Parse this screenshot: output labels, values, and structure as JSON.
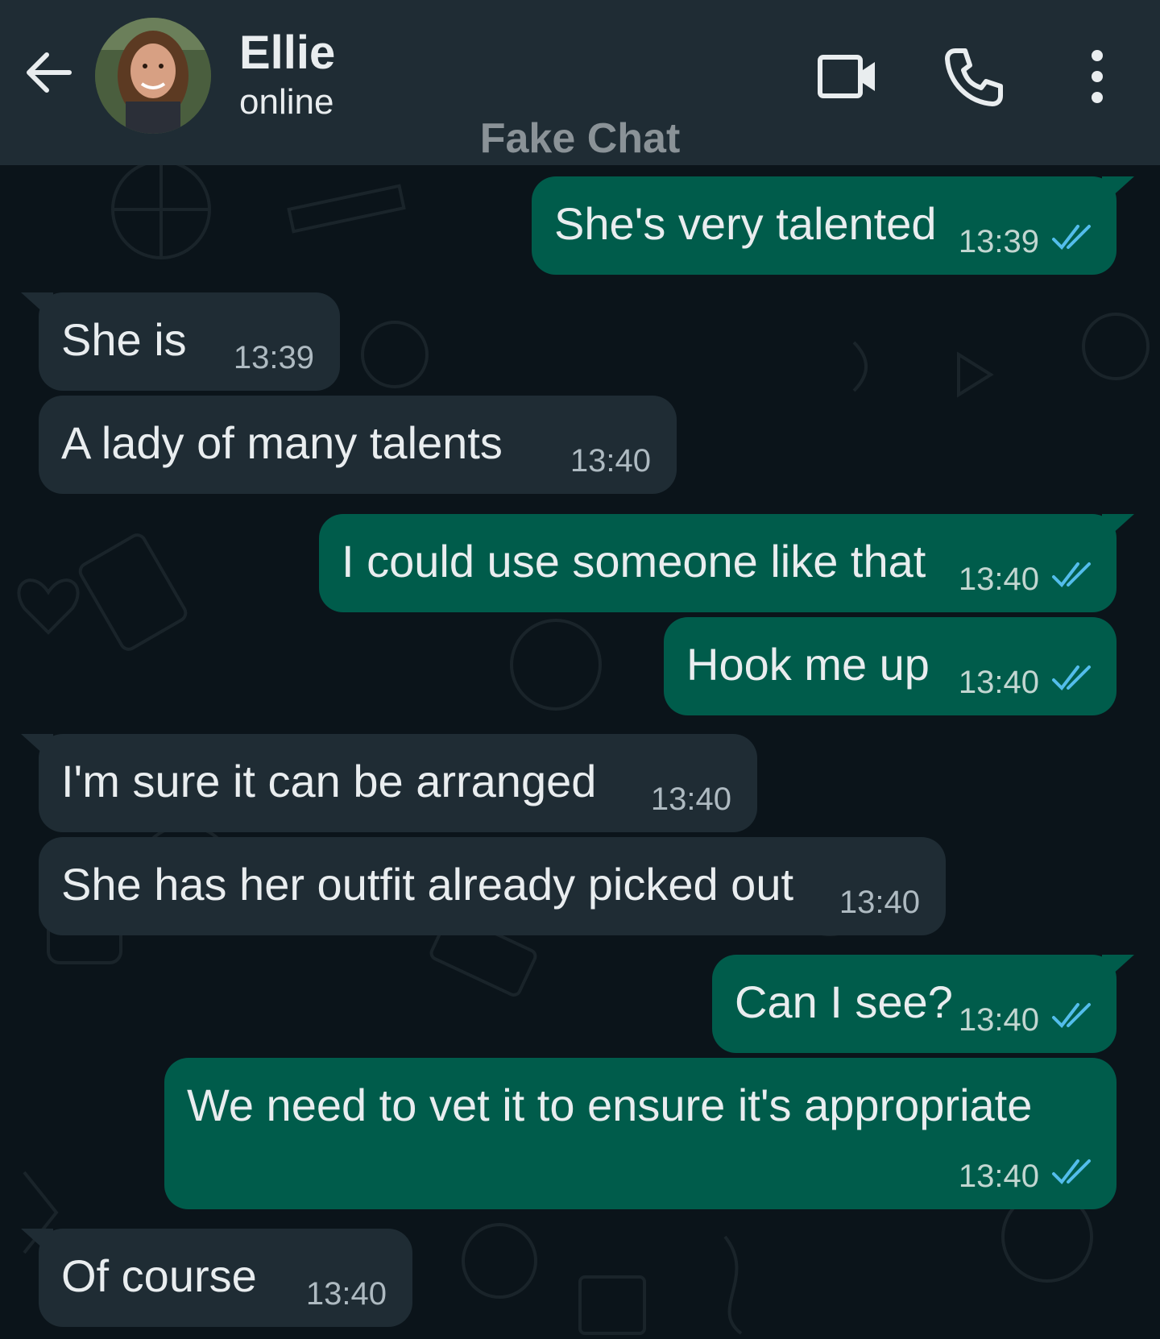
{
  "header": {
    "contact_name": "Ellie",
    "contact_status": "online",
    "watermark": "Fake Chat",
    "icons": [
      "back-arrow-icon",
      "avatar",
      "video-camera-icon",
      "phone-icon",
      "more-vertical-icon"
    ]
  },
  "colors": {
    "header_bg": "#1f2c34",
    "chat_bg": "#0b141a",
    "incoming_bubble": "#1f2c34",
    "outgoing_bubble": "#005c4b",
    "read_ticks": "#53bdeb"
  },
  "messages": [
    {
      "direction": "out",
      "text": "She's very talented",
      "time": "13:39",
      "read": true
    },
    {
      "direction": "in",
      "text": "She is",
      "time": "13:39"
    },
    {
      "direction": "in",
      "text": "A lady of many talents",
      "time": "13:40"
    },
    {
      "direction": "out",
      "text": "I could use someone like that",
      "time": "13:40",
      "read": true
    },
    {
      "direction": "out",
      "text": "Hook me up",
      "time": "13:40",
      "read": true
    },
    {
      "direction": "in",
      "text": "I'm sure it can be arranged",
      "time": "13:40"
    },
    {
      "direction": "in",
      "text": "She has her outfit already picked out",
      "time": "13:40"
    },
    {
      "direction": "out",
      "text": "Can I see?",
      "time": "13:40",
      "read": true
    },
    {
      "direction": "out",
      "text": "We need to vet it to ensure it's appropriate",
      "time": "13:40",
      "read": true
    },
    {
      "direction": "in",
      "text": "Of course",
      "time": "13:40"
    }
  ]
}
